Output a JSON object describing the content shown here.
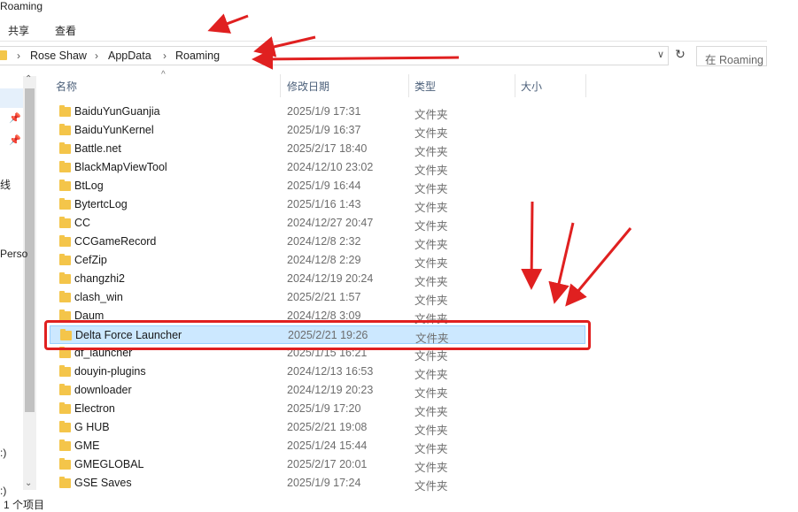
{
  "window": {
    "title": "Roaming"
  },
  "ribbon": {
    "tabs": [
      "共享",
      "查看"
    ]
  },
  "address": {
    "crumbs": [
      "Rose Shaw",
      "AppData",
      "Roaming"
    ],
    "search_placeholder": "在 Roaming"
  },
  "nav": {
    "fragments": [
      "线",
      "Perso",
      ":)",
      ":)"
    ]
  },
  "columns": {
    "name": "名称",
    "date": "修改日期",
    "type": "类型",
    "size": "大小"
  },
  "files": [
    {
      "name": "BaiduYunGuanjia",
      "date": "2025/1/9 17:31",
      "type": "文件夹"
    },
    {
      "name": "BaiduYunKernel",
      "date": "2025/1/9 16:37",
      "type": "文件夹"
    },
    {
      "name": "Battle.net",
      "date": "2025/2/17 18:40",
      "type": "文件夹"
    },
    {
      "name": "BlackMapViewTool",
      "date": "2024/12/10 23:02",
      "type": "文件夹"
    },
    {
      "name": "BtLog",
      "date": "2025/1/9 16:44",
      "type": "文件夹"
    },
    {
      "name": "BytertcLog",
      "date": "2025/1/16 1:43",
      "type": "文件夹"
    },
    {
      "name": "CC",
      "date": "2024/12/27 20:47",
      "type": "文件夹"
    },
    {
      "name": "CCGameRecord",
      "date": "2024/12/8 2:32",
      "type": "文件夹"
    },
    {
      "name": "CefZip",
      "date": "2024/12/8 2:29",
      "type": "文件夹"
    },
    {
      "name": "changzhi2",
      "date": "2024/12/19 20:24",
      "type": "文件夹"
    },
    {
      "name": "clash_win",
      "date": "2025/2/21 1:57",
      "type": "文件夹"
    },
    {
      "name": "Daum",
      "date": "2024/12/8 3:09",
      "type": "文件夹"
    },
    {
      "name": "Delta Force Launcher",
      "date": "2025/2/21 19:26",
      "type": "文件夹",
      "selected": true
    },
    {
      "name": "df_launcher",
      "date": "2025/1/15 16:21",
      "type": "文件夹"
    },
    {
      "name": "douyin-plugins",
      "date": "2024/12/13 16:53",
      "type": "文件夹"
    },
    {
      "name": "downloader",
      "date": "2024/12/19 20:23",
      "type": "文件夹"
    },
    {
      "name": "Electron",
      "date": "2025/1/9 17:20",
      "type": "文件夹"
    },
    {
      "name": "G HUB",
      "date": "2025/2/21 19:08",
      "type": "文件夹"
    },
    {
      "name": "GME",
      "date": "2025/1/24 15:44",
      "type": "文件夹"
    },
    {
      "name": "GMEGLOBAL",
      "date": "2025/2/17 20:01",
      "type": "文件夹"
    },
    {
      "name": "GSE Saves",
      "date": "2025/1/9 17:24",
      "type": "文件夹"
    }
  ],
  "status": {
    "text": "1 个项目"
  },
  "colors": {
    "selection": "#cce8ff",
    "annotation": "#e02020",
    "folder": "#f4c54a"
  }
}
